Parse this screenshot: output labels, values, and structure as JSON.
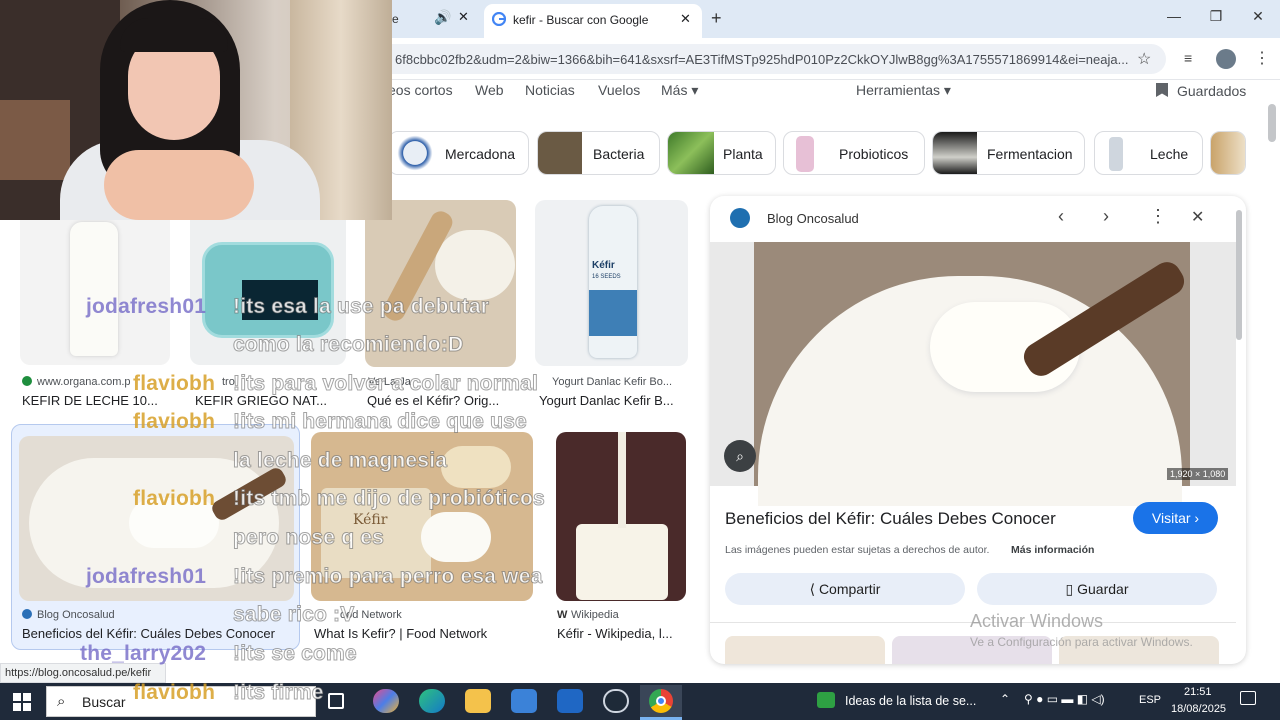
{
  "browser": {
    "inactive_tab_suffix": "e",
    "active_tab_title": "kefir - Buscar con Google",
    "url": "6f8cbbc02fb2&udm=2&biw=1366&bih=641&sxsrf=AE3TifMSTp925hdP010Pz2CkkOYJlwB8gg%3A1755571869914&ei=neaja...",
    "new_tab": "+",
    "minimize": "—",
    "maximize": "❐",
    "close": "✕"
  },
  "search_nav": {
    "items": [
      "eos cortos",
      "Web",
      "Noticias",
      "Vuelos",
      "Más ▾"
    ],
    "tools": "Herramientas ▾",
    "saved": "Guardados"
  },
  "chips": [
    "Mercadona",
    "Bacteria",
    "Planta",
    "Probioticos",
    "Fermentacion",
    "Leche"
  ],
  "results": [
    {
      "source": "www.organa.com.p",
      "title": "KEFIR DE LECHE 10..."
    },
    {
      "source": "tro",
      "title": "KEFIR GRIEGO NAT..."
    },
    {
      "source": "Ve La Ja",
      "title": "Qué es el Kéfir? Orig..."
    },
    {
      "source": "Yogurt Danlac Kefir Bo...",
      "title": "Yogurt Danlac Kefir B..."
    },
    {
      "source": "Blog Oncosalud",
      "title": "Beneficios del Kéfir: Cuáles Debes Conocer"
    },
    {
      "source": "ood Network",
      "title": "What Is Kefir? | Food Network"
    },
    {
      "source": "Wikipedia",
      "title": "Kéfir - Wikipedia, l..."
    }
  ],
  "kefir_label": "Kéfir",
  "kefir_bottle_sub": "16 SEEDS",
  "panel": {
    "source": "Blog Oncosalud",
    "dimensions": "1,920 × 1,080",
    "title": "Beneficios del Kéfir: Cuáles Debes Conocer",
    "visit": "Visitar ›",
    "rights": "Las imágenes pueden estar sujetas a derechos de autor.",
    "more_info": "Más información",
    "share": "Compartir",
    "save": "Guardar"
  },
  "status_url": "https://blog.oncosalud.pe/kefir",
  "watermark": {
    "line1": "Activar Windows",
    "line2": "Ve a Configuración para activar Windows."
  },
  "chat": [
    {
      "user": "jodafresh01",
      "msg": "!its esa la use pa debutar"
    },
    {
      "user": "",
      "msg": "como la recomiendo:D"
    },
    {
      "user": "flaviobh",
      "msg": "!its para volver a colar normal"
    },
    {
      "user": "flaviobh",
      "msg": "!its mi hermana dice que use"
    },
    {
      "user": "",
      "msg": "la leche de magnesia"
    },
    {
      "user": "flaviobh",
      "msg": "!its tmb me dijo de probióticos"
    },
    {
      "user": "",
      "msg": "pero nose q es"
    },
    {
      "user": "jodafresh01",
      "msg": "!its premio para perro esa wea"
    },
    {
      "user": "",
      "msg": "sabe rico :V"
    },
    {
      "user": "the_larry202",
      "msg": "!its se come"
    },
    {
      "user": "flaviobh",
      "msg": "!its firme"
    }
  ],
  "taskbar": {
    "search": "Buscar",
    "notification": "Ideas de la lista de se...",
    "lang": "ESP",
    "time": "21:51",
    "date": "18/08/2025"
  },
  "colors": {
    "accent": "#1a73e8",
    "taskbar": "#1f2a3a",
    "tabbar": "#dfe9f5"
  }
}
